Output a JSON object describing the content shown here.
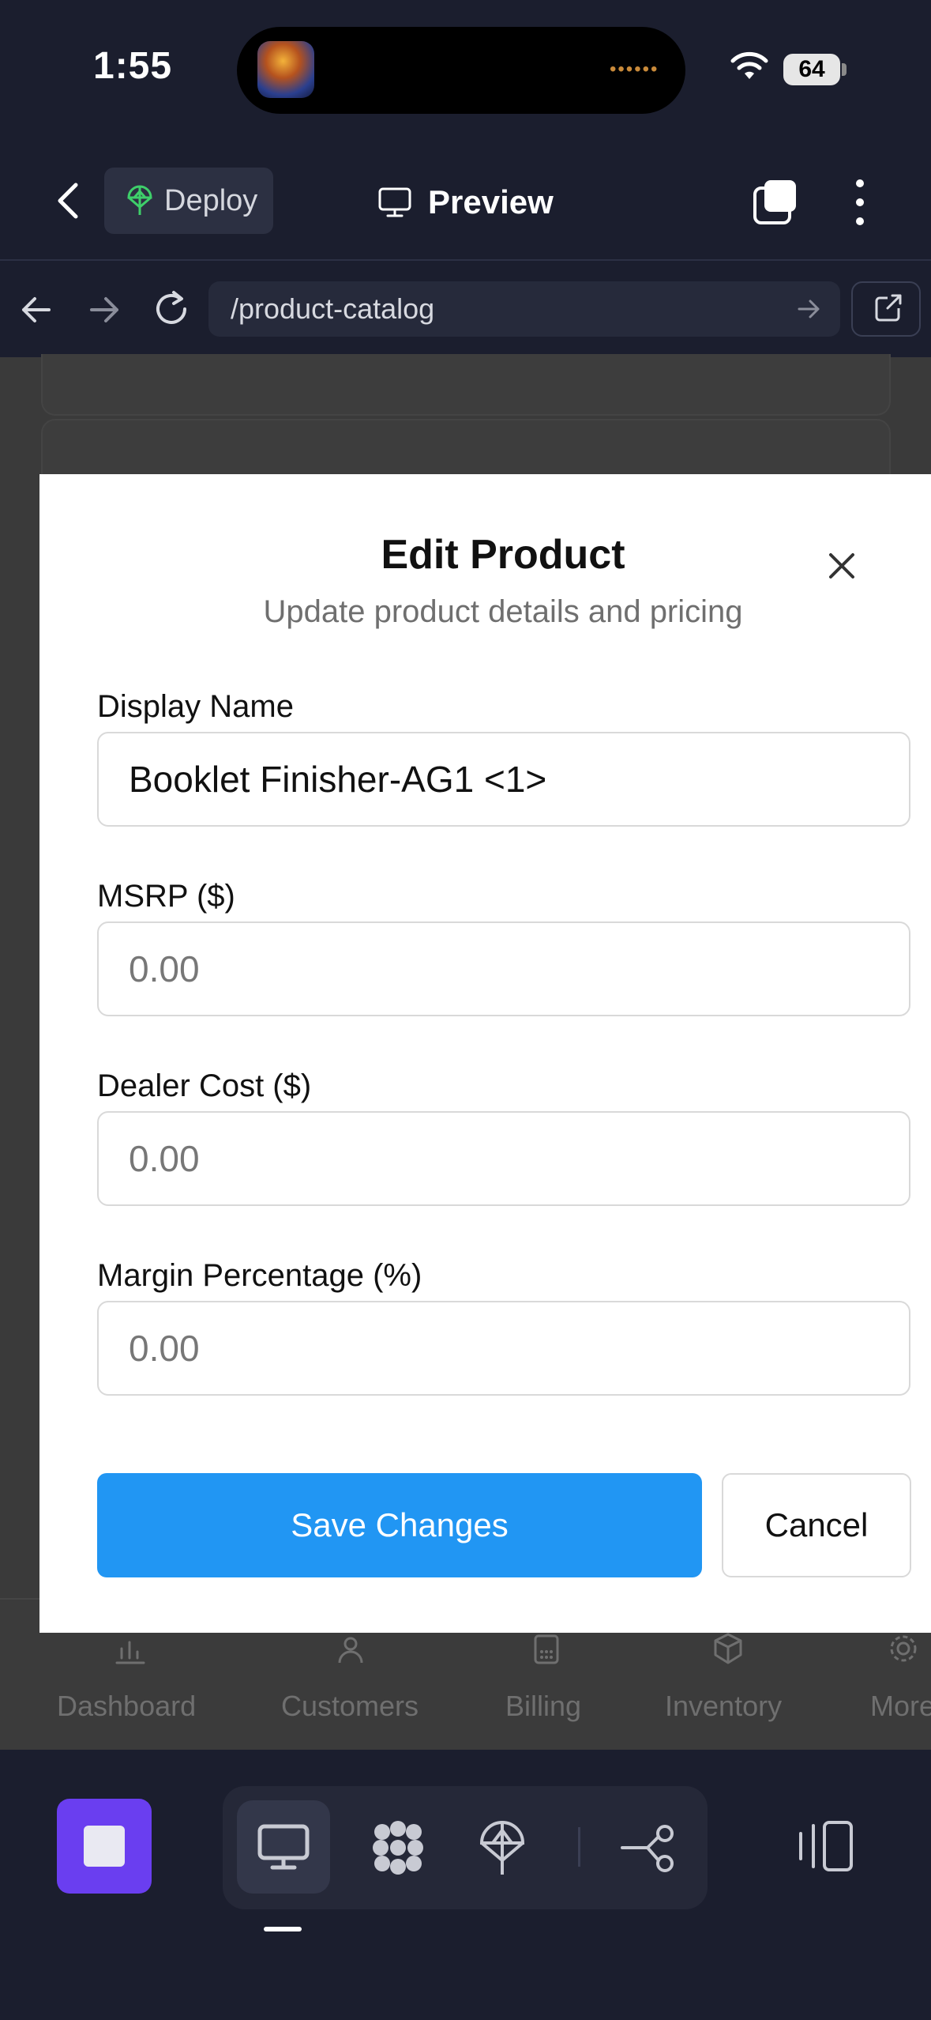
{
  "status_bar": {
    "time": "1:55",
    "battery": "64"
  },
  "top_bar": {
    "deploy_label": "Deploy",
    "preview_label": "Preview"
  },
  "url_bar": {
    "path": "/product-catalog"
  },
  "bottom_nav": {
    "items": [
      {
        "label": "Dashboard",
        "icon": "bar-chart-icon"
      },
      {
        "label": "Customers",
        "icon": "users-icon"
      },
      {
        "label": "Billing",
        "icon": "calculator-icon"
      },
      {
        "label": "Inventory",
        "icon": "box-icon"
      },
      {
        "label": "More",
        "icon": "gear-icon"
      }
    ]
  },
  "modal": {
    "title": "Edit Product",
    "subtitle": "Update product details and pricing",
    "fields": [
      {
        "label": "Display Name",
        "value": "Booklet Finisher-AG1 <1>",
        "placeholder": ""
      },
      {
        "label": "MSRP ($)",
        "value": "",
        "placeholder": "0.00"
      },
      {
        "label": "Dealer Cost ($)",
        "value": "",
        "placeholder": "0.00"
      },
      {
        "label": "Margin Percentage (%)",
        "value": "",
        "placeholder": "0.00"
      }
    ],
    "save_label": "Save Changes",
    "cancel_label": "Cancel"
  },
  "colors": {
    "primary": "#2196f3",
    "stop_button": "#6a3ef0",
    "app_chrome": "#1b1e2e",
    "deploy_icon": "#3ecf6a"
  }
}
